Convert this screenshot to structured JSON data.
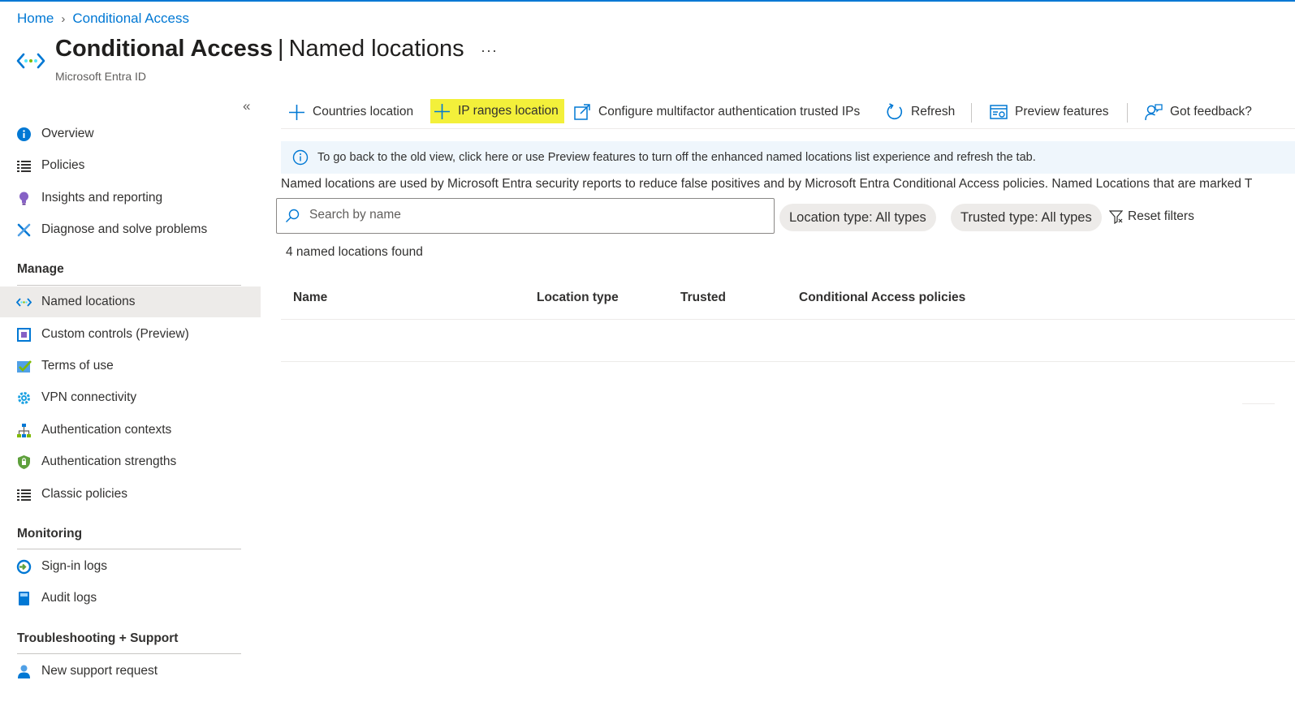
{
  "breadcrumb": {
    "home": "Home",
    "separator": "›",
    "current": "Conditional Access"
  },
  "header": {
    "title_main": "Conditional Access",
    "title_sep": "|",
    "title_page": "Named locations",
    "subtitle": "Microsoft Entra ID",
    "more": "···"
  },
  "sidebar": {
    "collapse": "«",
    "top_items": [
      {
        "label": "Overview",
        "icon": "info-icon"
      },
      {
        "label": "Policies",
        "icon": "list-icon"
      },
      {
        "label": "Insights and reporting",
        "icon": "lightbulb-icon"
      },
      {
        "label": "Diagnose and solve problems",
        "icon": "wrench-icon"
      }
    ],
    "manage_title": "Manage",
    "manage_items": [
      {
        "label": "Named locations",
        "icon": "named-locations-icon",
        "selected": true
      },
      {
        "label": "Custom controls (Preview)",
        "icon": "custom-controls-icon"
      },
      {
        "label": "Terms of use",
        "icon": "checkmark-icon"
      },
      {
        "label": "VPN connectivity",
        "icon": "gear-icon"
      },
      {
        "label": "Authentication contexts",
        "icon": "hierarchy-icon"
      },
      {
        "label": "Authentication strengths",
        "icon": "shield-icon"
      },
      {
        "label": "Classic policies",
        "icon": "list-icon"
      }
    ],
    "monitoring_title": "Monitoring",
    "monitoring_items": [
      {
        "label": "Sign-in logs",
        "icon": "sign-in-icon"
      },
      {
        "label": "Audit logs",
        "icon": "book-icon"
      }
    ],
    "support_title": "Troubleshooting + Support",
    "support_items": [
      {
        "label": "New support request",
        "icon": "person-icon"
      }
    ]
  },
  "toolbar": {
    "countries": "Countries location",
    "ip_ranges": "IP ranges location",
    "mfa": "Configure multifactor authentication trusted IPs",
    "refresh": "Refresh",
    "preview": "Preview features",
    "feedback": "Got feedback?"
  },
  "info": {
    "text": "To go back to the old view, click here or use Preview features to turn off the enhanced named locations list experience and refresh the tab."
  },
  "description": "Named locations are used by Microsoft Entra security reports to reduce false positives and by Microsoft Entra Conditional Access policies. Named Locations that are marked T",
  "search": {
    "placeholder": "Search by name"
  },
  "filters": {
    "location_type": "Location type: All types",
    "trusted_type": "Trusted type: All types",
    "reset": "Reset filters"
  },
  "results": {
    "count": "4 named locations found"
  },
  "table": {
    "columns": [
      "Name",
      "Location type",
      "Trusted",
      "Conditional Access policies"
    ]
  },
  "colors": {
    "accent": "#0078d4",
    "highlight": "#f3f03a",
    "selected_bg": "#edebe9"
  }
}
